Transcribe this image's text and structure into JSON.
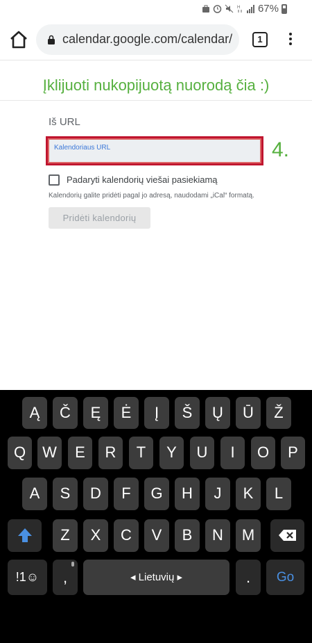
{
  "status": {
    "battery": "67%"
  },
  "browser": {
    "url": "calendar.google.com/calendar/",
    "tab_count": "1"
  },
  "banner": {
    "text": "Įklijuoti nukopijuotą nuorodą čia :)"
  },
  "form": {
    "section_label": "Iš URL",
    "url_placeholder": "Kalendoriaus URL",
    "step": "4.",
    "public_checkbox_label": "Padaryti kalendorių viešai pasiekiamą",
    "help_text": "Kalendorių galite pridėti pagal jo adresą, naudodami „iCal“ formatą.",
    "add_button": "Pridėti kalendorių"
  },
  "keyboard": {
    "row1": [
      "Ą",
      "Č",
      "Ę",
      "Ė",
      "Į",
      "Š",
      "Ų",
      "Ū",
      "Ž"
    ],
    "row2": [
      "Q",
      "W",
      "E",
      "R",
      "T",
      "Y",
      "U",
      "I",
      "O",
      "P"
    ],
    "row3": [
      "A",
      "S",
      "D",
      "F",
      "G",
      "H",
      "J",
      "K",
      "L"
    ],
    "row4": [
      "Z",
      "X",
      "C",
      "V",
      "B",
      "N",
      "M"
    ],
    "symbols_key": "!1☺",
    "comma_key": ",",
    "space_label": "Lietuvių",
    "period_key": ".",
    "go_key": "Go"
  }
}
